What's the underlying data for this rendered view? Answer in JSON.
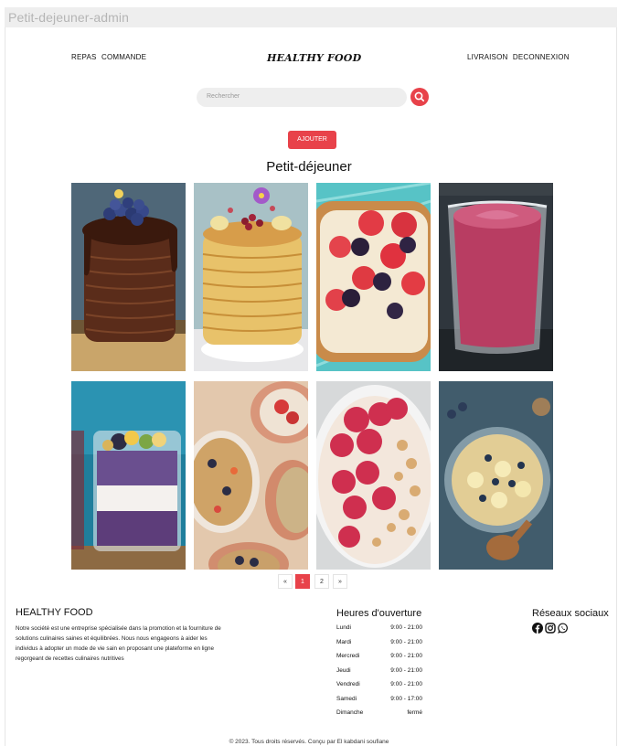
{
  "window": {
    "title": "Petit-dejeuner-admin"
  },
  "nav": {
    "left": [
      "REPAS",
      "COMMANDE"
    ],
    "logo": "HEALTHY FOOD",
    "right": [
      "LIVRAISON",
      "DECONNEXION"
    ]
  },
  "search": {
    "placeholder": "Rechercher",
    "icon": "search-icon"
  },
  "actions": {
    "add_label": "AJOUTER"
  },
  "section": {
    "title": "Petit-déjeuner"
  },
  "pagination": {
    "prev": "«",
    "pages": [
      "1",
      "2"
    ],
    "active": "1",
    "next": "»"
  },
  "footer": {
    "brand": "HEALTHY FOOD",
    "description": "Notre société est une entreprise spécialisée dans la promotion et la fourniture de solutions culinaires saines et équilibrées. Nous nous engageons à aider les individus à adopter un mode de vie sain en proposant une plateforme en ligne regorgeant de recettes culinaires nutritives",
    "hours_title": "Heures d'ouverture",
    "hours": [
      {
        "day": "Lundi",
        "time": "9:00 - 21:00"
      },
      {
        "day": "Mardi",
        "time": "9:00 - 21:00"
      },
      {
        "day": "Mercredi",
        "time": "9:00 - 21:00"
      },
      {
        "day": "Jeudi",
        "time": "9:00 - 21:00"
      },
      {
        "day": "Vendredi",
        "time": "9:00 - 21:00"
      },
      {
        "day": "Samedi",
        "time": "9:00 - 17:00"
      },
      {
        "day": "Dimanche",
        "time": "fermé"
      }
    ],
    "social_title": "Réseaux sociaux",
    "social_icons": [
      "facebook-icon",
      "instagram-icon",
      "whatsapp-icon"
    ],
    "copyright": "© 2023. Tous droits réservés. Conçu par El kabdani soufiane"
  },
  "colors": {
    "accent": "#e8424a",
    "search_bg": "#eeeeee",
    "titlebar_bg": "#eeeeee"
  }
}
